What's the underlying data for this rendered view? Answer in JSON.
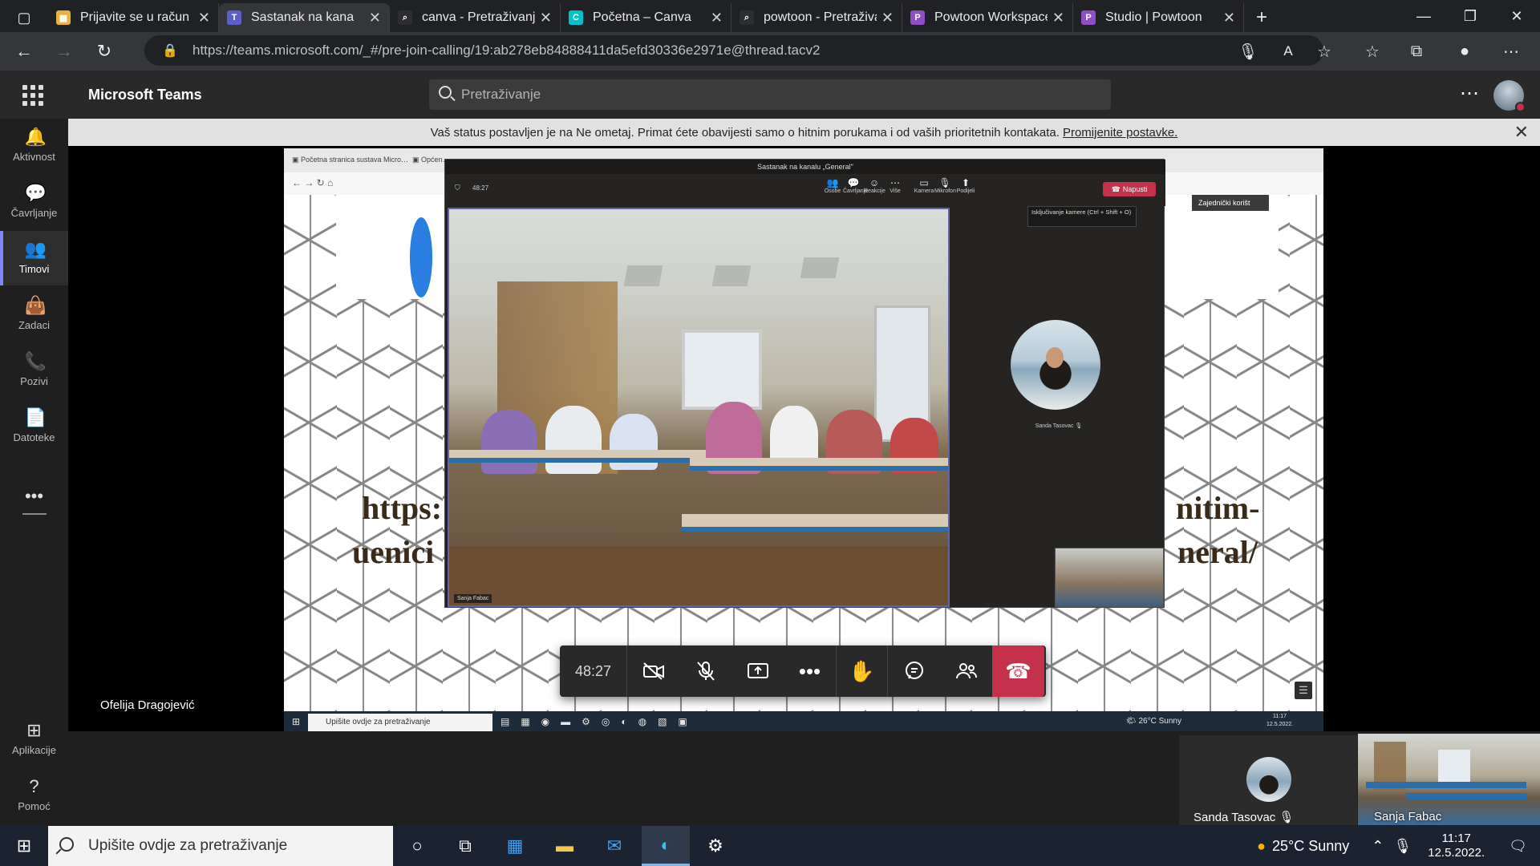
{
  "browser": {
    "tabs": [
      {
        "label": "Prijavite se u račun",
        "color": "#e8b23c",
        "glyph": "▦"
      },
      {
        "label": "Sastanak na kana",
        "color": "#5b5fc7",
        "glyph": "T"
      },
      {
        "label": "canva - Pretraživanje",
        "color": "#2d2e31",
        "glyph": "⌕"
      },
      {
        "label": "Početna – Canva",
        "color": "#00c4cc",
        "glyph": "C"
      },
      {
        "label": "powtoon - Pretraživan",
        "color": "#2d2e31",
        "glyph": "⌕"
      },
      {
        "label": "Powtoon Workspace",
        "color": "#8e4ec6",
        "glyph": "P"
      },
      {
        "label": "Studio | Powtoon",
        "color": "#8e4ec6",
        "glyph": "P"
      }
    ],
    "url": "https://teams.microsoft.com/_#/pre-join-calling/19:ab278eb84888411da5efd30336e2971e@thread.tacv2"
  },
  "teams": {
    "app_name": "Microsoft Teams",
    "search_placeholder": "Pretraživanje",
    "rail": [
      {
        "label": "Aktivnost",
        "icon": "bell-icon"
      },
      {
        "label": "Čavrljanje",
        "icon": "chat-icon"
      },
      {
        "label": "Timovi",
        "icon": "teams-icon"
      },
      {
        "label": "Zadaci",
        "icon": "tasks-icon"
      },
      {
        "label": "Pozivi",
        "icon": "phone-icon"
      },
      {
        "label": "Datoteke",
        "icon": "files-icon"
      }
    ],
    "rail_bottom": [
      {
        "label": "Aplikacije",
        "icon": "apps-icon"
      },
      {
        "label": "Pomoć",
        "icon": "help-icon"
      }
    ],
    "banner_text": "Vaš status postavljen je na Ne ometaj. Primat ćete obavijesti samo o hitnim porukama i od vaših prioritetnih kontakata.",
    "banner_link": "Promijenite postavke."
  },
  "shared_screen": {
    "big_text_left_1": "https:",
    "big_text_left_2": "uenici",
    "big_text_right_1": "nitim-",
    "big_text_right_2": "neral/",
    "taskbar_search": "Upišite ovdje za pretraživanje",
    "tray_weather": "26°C  Sunny",
    "tray_time": "11:17",
    "tray_date": "12.5.2022.",
    "inner_window_title": "Sastanak na kanalu „General\"",
    "inner_timer": "48:27",
    "inner_leave": "Napusti",
    "inner_tooltip": "Isključivanje kamere (Ctrl + Shift + O)",
    "inner_share_label": "Zajednički korišt",
    "inner_video_name": "Sanja Fabac",
    "inner_participant_name": "Sanda Tasovac",
    "inner_toolbar": [
      "Osobe",
      "Čavrljanje",
      "Reakcije",
      "Više",
      "Kamera",
      "Mikrofon",
      "Podijeli"
    ]
  },
  "meeting": {
    "timer": "48:27",
    "presenter_name": "Ofelija Dragojević",
    "participants": [
      {
        "name": "Sanda Tasovac"
      },
      {
        "name": "Sanja Fabac"
      }
    ]
  },
  "windows_taskbar": {
    "search_placeholder": "Upišite ovdje za pretraživanje",
    "weather": "25°C  Sunny",
    "time": "11:17",
    "date": "12.5.2022."
  }
}
